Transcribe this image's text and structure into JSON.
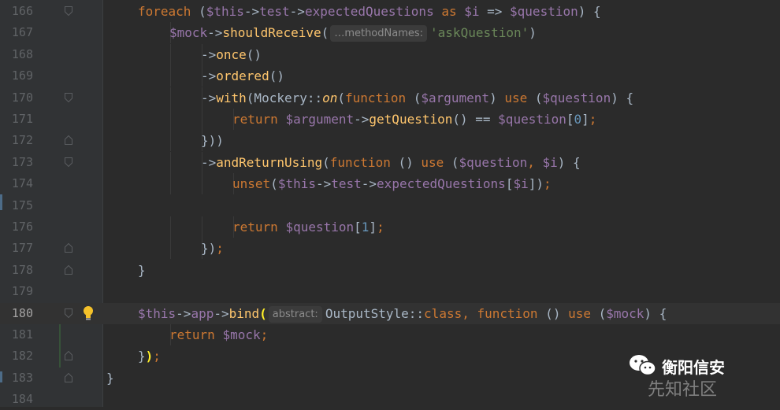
{
  "editor": {
    "current_line": "180",
    "lines": [
      {
        "num": "166",
        "indent": 2,
        "tokens": [
          {
            "t": "foreach",
            "c": "kw"
          },
          {
            "t": " (",
            "c": "plain"
          },
          {
            "t": "$this",
            "c": "var"
          },
          {
            "t": "->",
            "c": "plain"
          },
          {
            "t": "test",
            "c": "var"
          },
          {
            "t": "->",
            "c": "plain"
          },
          {
            "t": "expectedQuestions",
            "c": "var"
          },
          {
            "t": " as ",
            "c": "kw"
          },
          {
            "t": "$i",
            "c": "var"
          },
          {
            "t": " => ",
            "c": "plain"
          },
          {
            "t": "$question",
            "c": "var"
          },
          {
            "t": ") {",
            "c": "plain"
          }
        ]
      },
      {
        "num": "167",
        "indent": 3,
        "tokens": [
          {
            "t": "$mock",
            "c": "var"
          },
          {
            "t": "->",
            "c": "plain"
          },
          {
            "t": "shouldReceive",
            "c": "fn"
          },
          {
            "t": "(",
            "c": "plain"
          },
          {
            "hint": "…methodNames:"
          },
          {
            "t": "'askQuestion'",
            "c": "str"
          },
          {
            "t": ")",
            "c": "plain"
          }
        ]
      },
      {
        "num": "168",
        "indent": 4,
        "tokens": [
          {
            "t": "->",
            "c": "plain"
          },
          {
            "t": "once",
            "c": "fn"
          },
          {
            "t": "()",
            "c": "plain"
          }
        ]
      },
      {
        "num": "169",
        "indent": 4,
        "tokens": [
          {
            "t": "->",
            "c": "plain"
          },
          {
            "t": "ordered",
            "c": "fn"
          },
          {
            "t": "()",
            "c": "plain"
          }
        ]
      },
      {
        "num": "170",
        "indent": 4,
        "tokens": [
          {
            "t": "->",
            "c": "plain"
          },
          {
            "t": "with",
            "c": "fn"
          },
          {
            "t": "(Mockery::",
            "c": "plain"
          },
          {
            "t": "on",
            "c": "fn ital"
          },
          {
            "t": "(",
            "c": "plain"
          },
          {
            "t": "function",
            "c": "kw"
          },
          {
            "t": " (",
            "c": "plain"
          },
          {
            "t": "$argument",
            "c": "var"
          },
          {
            "t": ") ",
            "c": "plain"
          },
          {
            "t": "use",
            "c": "kw"
          },
          {
            "t": " (",
            "c": "plain"
          },
          {
            "t": "$question",
            "c": "var"
          },
          {
            "t": ") {",
            "c": "plain"
          }
        ]
      },
      {
        "num": "171",
        "indent": 5,
        "tokens": [
          {
            "t": "return ",
            "c": "kw"
          },
          {
            "t": "$argument",
            "c": "var"
          },
          {
            "t": "->",
            "c": "plain"
          },
          {
            "t": "getQuestion",
            "c": "fn"
          },
          {
            "t": "() == ",
            "c": "plain"
          },
          {
            "t": "$question",
            "c": "var"
          },
          {
            "t": "[",
            "c": "plain"
          },
          {
            "t": "0",
            "c": "num"
          },
          {
            "t": "]",
            "c": "plain"
          },
          {
            "t": ";",
            "c": "kw"
          }
        ]
      },
      {
        "num": "172",
        "indent": 4,
        "tokens": [
          {
            "t": "}))",
            "c": "plain"
          }
        ]
      },
      {
        "num": "173",
        "indent": 4,
        "tokens": [
          {
            "t": "->",
            "c": "plain"
          },
          {
            "t": "andReturnUsing",
            "c": "fn"
          },
          {
            "t": "(",
            "c": "plain"
          },
          {
            "t": "function",
            "c": "kw"
          },
          {
            "t": " () ",
            "c": "plain"
          },
          {
            "t": "use",
            "c": "kw"
          },
          {
            "t": " (",
            "c": "plain"
          },
          {
            "t": "$question",
            "c": "var"
          },
          {
            "t": ", ",
            "c": "kw"
          },
          {
            "t": "$i",
            "c": "var"
          },
          {
            "t": ") {",
            "c": "plain"
          }
        ]
      },
      {
        "num": "174",
        "indent": 5,
        "tokens": [
          {
            "t": "unset",
            "c": "kw"
          },
          {
            "t": "(",
            "c": "plain"
          },
          {
            "t": "$this",
            "c": "var"
          },
          {
            "t": "->",
            "c": "plain"
          },
          {
            "t": "test",
            "c": "var"
          },
          {
            "t": "->",
            "c": "plain"
          },
          {
            "t": "expectedQuestions",
            "c": "var"
          },
          {
            "t": "[",
            "c": "plain"
          },
          {
            "t": "$i",
            "c": "var"
          },
          {
            "t": "])",
            "c": "plain"
          },
          {
            "t": ";",
            "c": "kw"
          }
        ]
      },
      {
        "num": "175",
        "indent": 0,
        "tokens": []
      },
      {
        "num": "176",
        "indent": 5,
        "tokens": [
          {
            "t": "return ",
            "c": "kw"
          },
          {
            "t": "$question",
            "c": "var"
          },
          {
            "t": "[",
            "c": "plain"
          },
          {
            "t": "1",
            "c": "num"
          },
          {
            "t": "]",
            "c": "plain"
          },
          {
            "t": ";",
            "c": "kw"
          }
        ]
      },
      {
        "num": "177",
        "indent": 4,
        "tokens": [
          {
            "t": "})",
            "c": "plain"
          },
          {
            "t": ";",
            "c": "kw"
          }
        ]
      },
      {
        "num": "178",
        "indent": 2,
        "tokens": [
          {
            "t": "}",
            "c": "plain"
          }
        ]
      },
      {
        "num": "179",
        "indent": 0,
        "tokens": []
      },
      {
        "num": "180",
        "indent": 2,
        "tokens": [
          {
            "t": "$this",
            "c": "var"
          },
          {
            "t": "->",
            "c": "plain"
          },
          {
            "t": "app",
            "c": "var"
          },
          {
            "t": "->",
            "c": "plain"
          },
          {
            "t": "bind",
            "c": "fn"
          },
          {
            "t": "(",
            "c": "brace-match"
          },
          {
            "hint": "abstract:"
          },
          {
            "t": "OutputStyle",
            "c": "plain"
          },
          {
            "t": "::",
            "c": "plain"
          },
          {
            "t": "class",
            "c": "kw"
          },
          {
            "t": ", ",
            "c": "kw"
          },
          {
            "t": "function",
            "c": "kw"
          },
          {
            "t": " () ",
            "c": "plain"
          },
          {
            "t": "use",
            "c": "kw"
          },
          {
            "t": " (",
            "c": "plain"
          },
          {
            "t": "$mock",
            "c": "var"
          },
          {
            "t": ") {",
            "c": "plain"
          }
        ]
      },
      {
        "num": "181",
        "indent": 3,
        "tokens": [
          {
            "t": "return ",
            "c": "kw"
          },
          {
            "t": "$mock",
            "c": "var"
          },
          {
            "t": ";",
            "c": "kw"
          }
        ]
      },
      {
        "num": "182",
        "indent": 2,
        "tokens": [
          {
            "t": "}",
            "c": "plain"
          },
          {
            "t": ")",
            "c": "brace-match"
          },
          {
            "t": ";",
            "c": "kw"
          }
        ]
      },
      {
        "num": "183",
        "indent": 1,
        "tokens": [
          {
            "t": "}",
            "c": "plain"
          }
        ]
      },
      {
        "num": "184",
        "indent": 0,
        "tokens": []
      }
    ],
    "fold_markers": {
      "166": "open",
      "167": "none",
      "168": "none",
      "169": "none",
      "170": "open",
      "171": "none",
      "172": "close",
      "173": "open",
      "174": "none",
      "175": "none",
      "176": "none",
      "177": "close",
      "178": "close",
      "179": "none",
      "180": "open",
      "181": "none",
      "182": "close",
      "183": "close",
      "184": "none"
    },
    "intention_icon": "lightbulb-icon"
  },
  "watermark": {
    "title": "衡阳信安",
    "subtitle": "先知社区",
    "logo_icon": "wechat-icon"
  },
  "colors": {
    "background": "#2b2b2b",
    "keyword": "#cc7832",
    "variable": "#9876aa",
    "function": "#ffc66d",
    "string": "#6a8759",
    "number": "#6897bb"
  }
}
